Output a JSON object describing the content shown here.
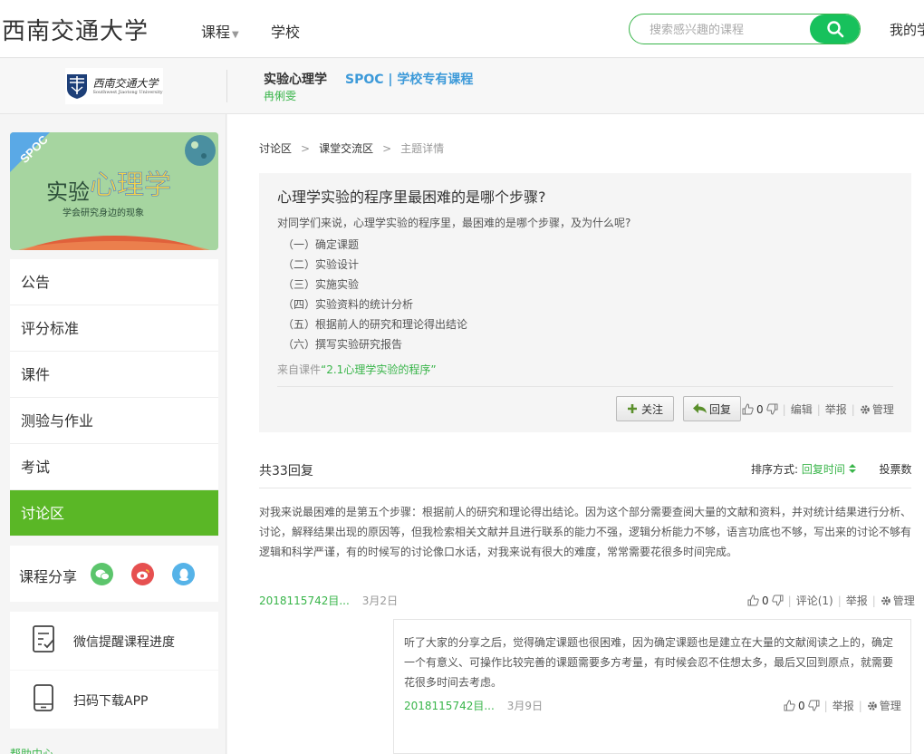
{
  "topbar": {
    "university": "西南交通大学",
    "nav_course": "课程",
    "nav_school": "学校",
    "search_placeholder": "搜索感兴趣的课程",
    "mine": "我的学"
  },
  "course_header": {
    "logo_text": "西南交通大学",
    "logo_sub": "Southwest Jiaotong University",
    "course_name": "实验心理学",
    "spoc_label": "SPOC | 学校专有课程",
    "teacher": "冉俐雯"
  },
  "sidebar": {
    "cover": {
      "spoc_ribbon": "SPOC",
      "title_part1": "实验",
      "title_part2": "心理学",
      "subtitle": "学会研究身边的现象"
    },
    "menu": [
      {
        "label": "公告"
      },
      {
        "label": "评分标准"
      },
      {
        "label": "课件"
      },
      {
        "label": "测验与作业"
      },
      {
        "label": "考试"
      },
      {
        "label": "讨论区"
      }
    ],
    "share_label": "课程分享",
    "tool_wechat": "微信提醒课程进度",
    "tool_app": "扫码下载APP",
    "help": "帮助中心"
  },
  "breadcrumb": {
    "item1": "讨论区",
    "item2": "课堂交流区",
    "item3": "主题详情"
  },
  "topic": {
    "title": "心理学实验的程序里最困难的是哪个步骤?",
    "intro": "对同学们来说，心理学实验的程序里，最困难的是哪个步骤，及为什么呢?",
    "steps": [
      "（一）确定课题",
      "（二）实验设计",
      "（三）实施实验",
      "（四）实验资料的统计分析",
      "（五）根据前人的研究和理论得出结论",
      "（六）撰写实验研究报告"
    ],
    "from_prefix": "来自课件",
    "from_link": "“2.1心理学实验的程序”",
    "follow_btn": "关注",
    "reply_btn": "回复",
    "like_count": "0",
    "edit": "编辑",
    "report": "举报",
    "manage": "管理"
  },
  "replies": {
    "count_label": "共33回复",
    "sort_label": "排序方式:",
    "sort_active": "回复时间",
    "sort_votes": "投票数",
    "first": {
      "text": "对我来说最困难的是第五个步骤：根据前人的研究和理论得出结论。因为这个部分需要查阅大量的文献和资料，并对统计结果进行分析、讨论，解释结果出现的原因等，但我检索相关文献并且进行联系的能力不强，逻辑分析能力不够，语言功底也不够，写出来的讨论不够有逻辑和科学严谨，有的时候写的讨论像口水话，对我来说有很大的难度，常常需要花很多时间完成。",
      "author": "2018115742目...",
      "date": "3月2日",
      "like_count": "0",
      "comments": "评论(1)",
      "report": "举报",
      "manage": "管理"
    },
    "comment": {
      "text": "听了大家的分享之后，觉得确定课题也很困难，因为确定课题也是建立在大量的文献阅读之上的，确定一个有意义、可操作比较完善的课题需要多方考量，有时候会忍不住想太多，最后又回到原点，就需要花很多时间去考虑。",
      "author": "2018115742目...",
      "date": "3月9日",
      "like_count": "0",
      "report": "举报",
      "manage": "管理"
    }
  },
  "colors": {
    "accent_green": "#39b54a",
    "menu_active": "#5ab726",
    "search_button": "#17c15c",
    "spoc_blue": "#3d9ad9"
  },
  "icons": [
    "search-icon",
    "wechat-icon",
    "weibo-icon",
    "qq-icon",
    "plus-icon",
    "reply-arrow-icon",
    "thumb-up-icon",
    "thumb-down-icon",
    "gear-icon",
    "checklist-icon",
    "phone-icon",
    "caret-down-icon",
    "sort-icon"
  ]
}
